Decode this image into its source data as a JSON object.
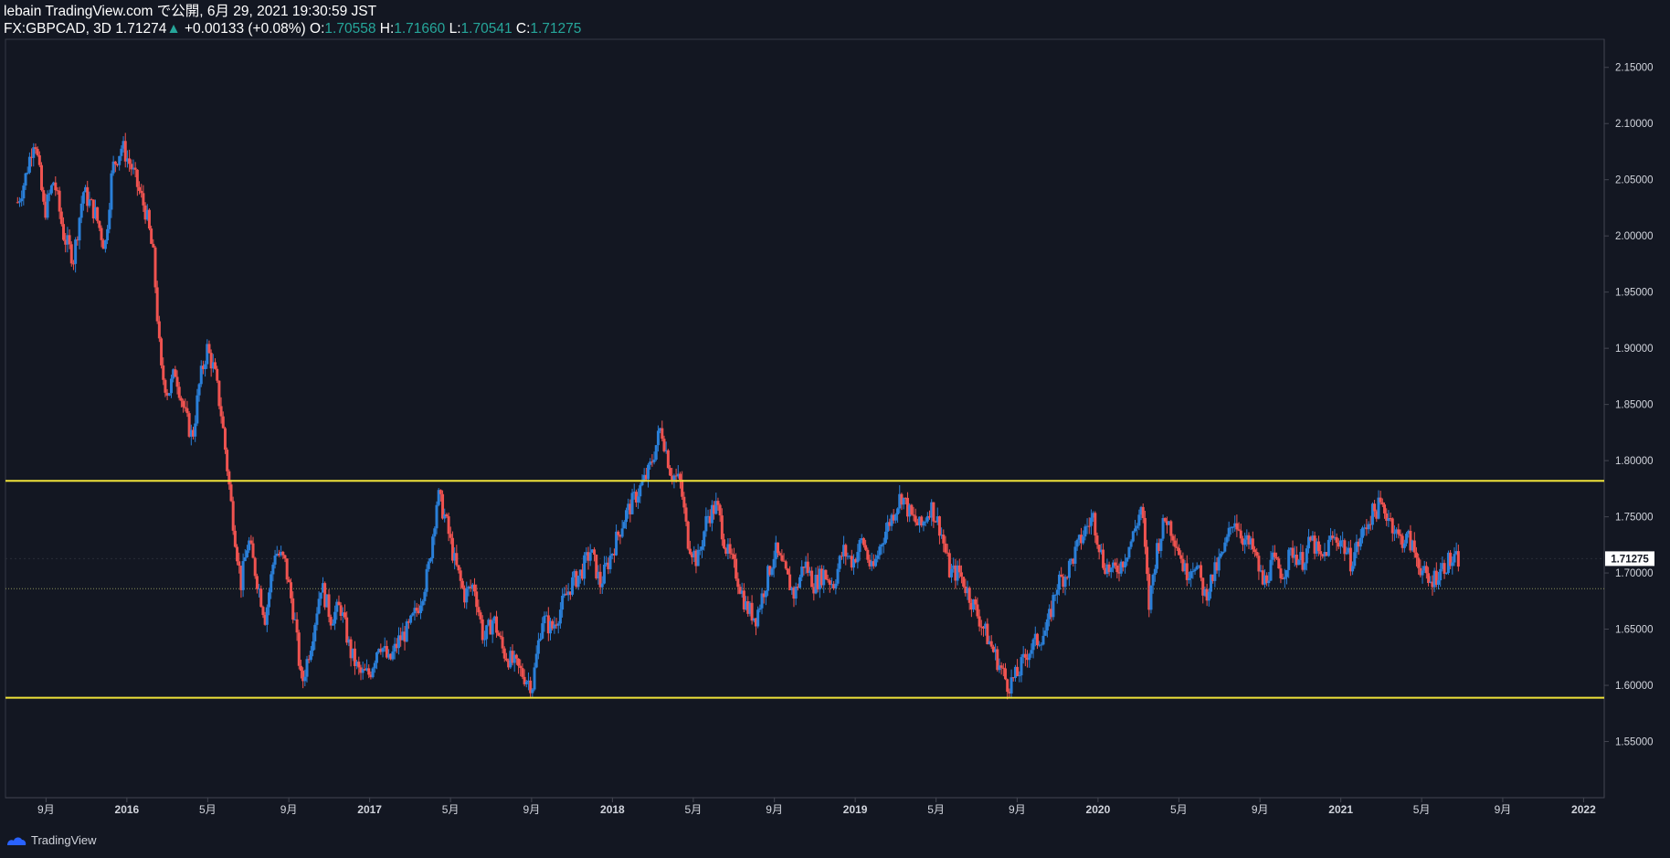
{
  "header": {
    "line1": "lebain TradingView.com で公開, 6月 29, 2021 19:30:59 JST",
    "symbol": "FX:GBPCAD, 3D",
    "last": "1.71274",
    "change_arrow": "▲",
    "change": "+0.00133 (+0.08%)",
    "o_label": "O:",
    "o_value": "1.70558",
    "h_label": "H:",
    "h_value": "1.71660",
    "l_label": "L:",
    "l_value": "1.70541",
    "c_label": "C:",
    "c_value": "1.71275"
  },
  "footer": {
    "brand": "TradingView"
  },
  "colors": {
    "background": "#131722",
    "up": "#2a7fd8",
    "down": "#ef5350",
    "level_line": "#f0e33a",
    "axis_text": "#d1d4dc",
    "price_badge_bg": "#ffffff",
    "price_badge_text": "#131722"
  },
  "chart_data": {
    "type": "candlestick",
    "symbol": "FX:GBPCAD",
    "interval": "3D",
    "ylim": [
      1.5,
      2.175
    ],
    "y_ticks": [
      "2.15000",
      "2.10000",
      "2.05000",
      "2.00000",
      "1.95000",
      "1.90000",
      "1.85000",
      "1.80000",
      "1.75000",
      "1.70000",
      "1.65000",
      "1.60000",
      "1.55000"
    ],
    "current_price_label": "1.71275",
    "current_price": 1.71275,
    "x_ticks": [
      {
        "t": 2015.667,
        "label": "9月"
      },
      {
        "t": 2016.0,
        "label": "2016"
      },
      {
        "t": 2016.333,
        "label": "5月"
      },
      {
        "t": 2016.667,
        "label": "9月"
      },
      {
        "t": 2017.0,
        "label": "2017"
      },
      {
        "t": 2017.333,
        "label": "5月"
      },
      {
        "t": 2017.667,
        "label": "9月"
      },
      {
        "t": 2018.0,
        "label": "2018"
      },
      {
        "t": 2018.333,
        "label": "5月"
      },
      {
        "t": 2018.667,
        "label": "9月"
      },
      {
        "t": 2019.0,
        "label": "2019"
      },
      {
        "t": 2019.333,
        "label": "5月"
      },
      {
        "t": 2019.667,
        "label": "9月"
      },
      {
        "t": 2020.0,
        "label": "2020"
      },
      {
        "t": 2020.333,
        "label": "5月"
      },
      {
        "t": 2020.667,
        "label": "9月"
      },
      {
        "t": 2021.0,
        "label": "2021"
      },
      {
        "t": 2021.333,
        "label": "5月"
      },
      {
        "t": 2021.667,
        "label": "9月"
      },
      {
        "t": 2022.0,
        "label": "2022"
      }
    ],
    "horizontal_lines": [
      {
        "price": 1.782
      },
      {
        "price": 1.589
      }
    ],
    "dotted_line": 1.686,
    "price_path": [
      [
        2015.55,
        2.03
      ],
      [
        2015.58,
        2.05
      ],
      [
        2015.62,
        2.09
      ],
      [
        2015.66,
        2.02
      ],
      [
        2015.7,
        2.05
      ],
      [
        2015.74,
        2.0
      ],
      [
        2015.78,
        1.98
      ],
      [
        2015.82,
        2.04
      ],
      [
        2015.87,
        2.02
      ],
      [
        2015.91,
        1.99
      ],
      [
        2015.94,
        2.06
      ],
      [
        2015.98,
        2.08
      ],
      [
        2016.02,
        2.06
      ],
      [
        2016.05,
        2.04
      ],
      [
        2016.08,
        2.02
      ],
      [
        2016.11,
        1.98
      ],
      [
        2016.14,
        1.88
      ],
      [
        2016.17,
        1.86
      ],
      [
        2016.2,
        1.88
      ],
      [
        2016.24,
        1.84
      ],
      [
        2016.27,
        1.82
      ],
      [
        2016.3,
        1.87
      ],
      [
        2016.33,
        1.9
      ],
      [
        2016.36,
        1.88
      ],
      [
        2016.39,
        1.84
      ],
      [
        2016.43,
        1.76
      ],
      [
        2016.47,
        1.69
      ],
      [
        2016.5,
        1.73
      ],
      [
        2016.54,
        1.69
      ],
      [
        2016.57,
        1.66
      ],
      [
        2016.61,
        1.72
      ],
      [
        2016.65,
        1.71
      ],
      [
        2016.69,
        1.66
      ],
      [
        2016.72,
        1.6
      ],
      [
        2016.76,
        1.64
      ],
      [
        2016.8,
        1.69
      ],
      [
        2016.84,
        1.66
      ],
      [
        2016.88,
        1.67
      ],
      [
        2016.92,
        1.63
      ],
      [
        2016.96,
        1.61
      ],
      [
        2017.0,
        1.61
      ],
      [
        2017.04,
        1.64
      ],
      [
        2017.08,
        1.62
      ],
      [
        2017.12,
        1.64
      ],
      [
        2017.16,
        1.65
      ],
      [
        2017.2,
        1.67
      ],
      [
        2017.24,
        1.7
      ],
      [
        2017.28,
        1.77
      ],
      [
        2017.31,
        1.75
      ],
      [
        2017.35,
        1.71
      ],
      [
        2017.39,
        1.68
      ],
      [
        2017.43,
        1.69
      ],
      [
        2017.47,
        1.64
      ],
      [
        2017.51,
        1.66
      ],
      [
        2017.55,
        1.63
      ],
      [
        2017.59,
        1.62
      ],
      [
        2017.63,
        1.61
      ],
      [
        2017.67,
        1.6
      ],
      [
        2017.71,
        1.66
      ],
      [
        2017.75,
        1.65
      ],
      [
        2017.79,
        1.67
      ],
      [
        2017.83,
        1.69
      ],
      [
        2017.87,
        1.7
      ],
      [
        2017.91,
        1.72
      ],
      [
        2017.95,
        1.69
      ],
      [
        2018.0,
        1.72
      ],
      [
        2018.05,
        1.75
      ],
      [
        2018.1,
        1.77
      ],
      [
        2018.15,
        1.79
      ],
      [
        2018.2,
        1.83
      ],
      [
        2018.24,
        1.79
      ],
      [
        2018.28,
        1.78
      ],
      [
        2018.31,
        1.73
      ],
      [
        2018.35,
        1.71
      ],
      [
        2018.39,
        1.75
      ],
      [
        2018.43,
        1.76
      ],
      [
        2018.47,
        1.72
      ],
      [
        2018.51,
        1.7
      ],
      [
        2018.55,
        1.67
      ],
      [
        2018.59,
        1.66
      ],
      [
        2018.63,
        1.69
      ],
      [
        2018.67,
        1.72
      ],
      [
        2018.71,
        1.7
      ],
      [
        2018.75,
        1.68
      ],
      [
        2018.79,
        1.71
      ],
      [
        2018.83,
        1.69
      ],
      [
        2018.87,
        1.7
      ],
      [
        2018.91,
        1.69
      ],
      [
        2018.95,
        1.72
      ],
      [
        2018.99,
        1.71
      ],
      [
        2019.03,
        1.73
      ],
      [
        2019.07,
        1.7
      ],
      [
        2019.11,
        1.73
      ],
      [
        2019.15,
        1.75
      ],
      [
        2019.19,
        1.77
      ],
      [
        2019.23,
        1.75
      ],
      [
        2019.27,
        1.74
      ],
      [
        2019.31,
        1.76
      ],
      [
        2019.35,
        1.74
      ],
      [
        2019.39,
        1.7
      ],
      [
        2019.43,
        1.7
      ],
      [
        2019.47,
        1.68
      ],
      [
        2019.51,
        1.66
      ],
      [
        2019.55,
        1.64
      ],
      [
        2019.59,
        1.62
      ],
      [
        2019.63,
        1.6
      ],
      [
        2019.67,
        1.61
      ],
      [
        2019.71,
        1.63
      ],
      [
        2019.75,
        1.64
      ],
      [
        2019.79,
        1.65
      ],
      [
        2019.83,
        1.69
      ],
      [
        2019.87,
        1.7
      ],
      [
        2019.91,
        1.72
      ],
      [
        2019.95,
        1.74
      ],
      [
        2019.98,
        1.75
      ],
      [
        2020.02,
        1.71
      ],
      [
        2020.06,
        1.7
      ],
      [
        2020.1,
        1.71
      ],
      [
        2020.14,
        1.73
      ],
      [
        2020.18,
        1.76
      ],
      [
        2020.21,
        1.67
      ],
      [
        2020.24,
        1.72
      ],
      [
        2020.28,
        1.75
      ],
      [
        2020.32,
        1.73
      ],
      [
        2020.36,
        1.7
      ],
      [
        2020.4,
        1.71
      ],
      [
        2020.44,
        1.68
      ],
      [
        2020.48,
        1.7
      ],
      [
        2020.52,
        1.72
      ],
      [
        2020.56,
        1.75
      ],
      [
        2020.6,
        1.73
      ],
      [
        2020.64,
        1.72
      ],
      [
        2020.68,
        1.69
      ],
      [
        2020.72,
        1.71
      ],
      [
        2020.76,
        1.7
      ],
      [
        2020.8,
        1.72
      ],
      [
        2020.84,
        1.71
      ],
      [
        2020.88,
        1.73
      ],
      [
        2020.92,
        1.71
      ],
      [
        2020.96,
        1.73
      ],
      [
        2021.0,
        1.73
      ],
      [
        2021.04,
        1.71
      ],
      [
        2021.08,
        1.73
      ],
      [
        2021.12,
        1.75
      ],
      [
        2021.16,
        1.76
      ],
      [
        2021.2,
        1.75
      ],
      [
        2021.24,
        1.73
      ],
      [
        2021.28,
        1.73
      ],
      [
        2021.32,
        1.71
      ],
      [
        2021.36,
        1.69
      ],
      [
        2021.4,
        1.7
      ],
      [
        2021.44,
        1.71
      ],
      [
        2021.47,
        1.71
      ],
      [
        2021.49,
        1.713
      ]
    ]
  }
}
